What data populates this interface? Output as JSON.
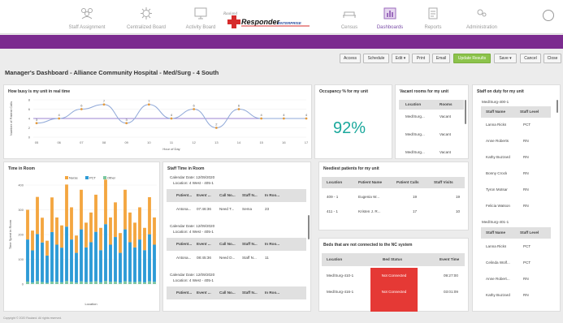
{
  "nav": {
    "items": [
      {
        "label": "Staff Assignment",
        "icon": "staff-icon"
      },
      {
        "label": "Centralized Board",
        "icon": "board-icon"
      },
      {
        "label": "Activity Board",
        "icon": "monitor-icon"
      },
      {
        "label": "Census",
        "icon": "bed-icon"
      },
      {
        "label": "Dashboards",
        "icon": "dashboard-icon"
      },
      {
        "label": "Reports",
        "icon": "report-icon"
      },
      {
        "label": "Administration",
        "icon": "admin-icon"
      }
    ],
    "logo_small": "Rauland",
    "logo_main": "Responder",
    "logo_edition": "ENTERPRISE",
    "active": "Dashboards"
  },
  "toolbar": {
    "buttons": [
      "Access",
      "Schedule",
      "Edit",
      "Print",
      "Email",
      "Update Results",
      "Save",
      "Cancel",
      "Close"
    ]
  },
  "page_title": "Manager's Dashboard - Alliance Community Hospital - Med/Surg - 4 South",
  "busy": {
    "title": "How busy is my unit in real time",
    "ylabel": "Number of Patient Calls",
    "xlabel": "Hour of Day",
    "chart_data": {
      "type": "line",
      "x": [
        "05",
        "06",
        "07",
        "08",
        "09",
        "10",
        "11",
        "12",
        "13",
        "14",
        "15",
        "16",
        "17"
      ],
      "values": [
        3,
        4,
        6,
        7,
        3,
        7,
        4,
        6,
        2,
        6,
        4,
        4,
        4
      ],
      "ylim": [
        0,
        8
      ],
      "series_color": "#8fa8d8"
    }
  },
  "occupancy": {
    "title": "Occupancy % for my unit",
    "value": "92%"
  },
  "vacant": {
    "title": "Vacant rooms for my unit",
    "headers": [
      "Location",
      "Rooms"
    ],
    "rows": [
      [
        "Med/Surg...",
        "Vacant"
      ],
      [
        "Med/Surg...",
        "Vacant"
      ],
      [
        "Med/Surg...",
        "Vacant"
      ]
    ]
  },
  "staff_on_duty": {
    "title": "Staff on duty for my unit",
    "group1": "Med/Surg-400-1",
    "group2": "Med/Surg-401-1",
    "headers": [
      "Staff Name",
      "Staff Level"
    ],
    "rows1": [
      [
        "Lanna Ricks",
        "PCT"
      ],
      [
        "Anne Roberts",
        "RN"
      ],
      [
        "Kathy Buzzard",
        "RN"
      ],
      [
        "Bonny Crock",
        "RN"
      ],
      [
        "Tyron Motsar",
        "RN"
      ],
      [
        "Felicia Watson",
        "RN"
      ]
    ],
    "rows2": [
      [
        "Lanna Ricks",
        "PCT"
      ],
      [
        "Celinda Wolf...",
        "PCT"
      ],
      [
        "Anne Robert...",
        "RN"
      ],
      [
        "Kathy Buzzard",
        "RN"
      ]
    ]
  },
  "time_in_room": {
    "title": "Time in Room",
    "ylabel": "Time Spent in Room",
    "xlabel": "Location",
    "legend": [
      "Nurse",
      "PCT",
      "Other"
    ],
    "chart_data": {
      "type": "bar",
      "stacked": true,
      "series": [
        {
          "name": "Nurse",
          "color": "#f4a640",
          "values": [
            120,
            80,
            150,
            100,
            60,
            140,
            110,
            90,
            170,
            130,
            70,
            160,
            100,
            120,
            150,
            90,
            180,
            110,
            140,
            80,
            160,
            120,
            100,
            130,
            90,
            150,
            110
          ]
        },
        {
          "name": "PCT",
          "color": "#2d9bd6",
          "values": [
            170,
            130,
            190,
            160,
            110,
            200,
            150,
            140,
            220,
            170,
            120,
            210,
            140,
            160,
            200,
            130,
            230,
            150,
            180,
            120,
            210,
            160,
            140,
            170,
            130,
            190,
            150
          ]
        },
        {
          "name": "Other",
          "color": "#7cc7a0",
          "values": [
            10,
            6,
            12,
            8,
            5,
            10,
            9,
            7,
            12,
            10,
            6,
            11,
            8,
            9,
            11,
            7,
            12,
            9,
            10,
            6,
            11,
            9,
            8,
            10,
            7,
            11,
            9
          ]
        }
      ],
      "ylim": [
        0,
        400
      ]
    }
  },
  "staff_time": {
    "title": "Staff Time in Room",
    "headers": [
      "Patient...",
      "Event ...",
      "Call No...",
      "Staff N...",
      "In Roo..."
    ],
    "blocks": [
      {
        "date": "Calendar Date: 12/09/2020",
        "loc": "Location: 4 West - 405-1",
        "row": [
          "Antona...",
          "07:46:36",
          "Need T...",
          "Sema",
          "23"
        ]
      },
      {
        "date": "Calendar Date: 12/09/2020",
        "loc": "Location: 4 West - 405-1",
        "row": [
          "Antona...",
          "08:45:36",
          "Need D...",
          "Staff N...",
          "11"
        ]
      },
      {
        "date": "Calendar Date: 12/09/2020",
        "loc": "Location: 4 West - 405-1",
        "row": [
          "",
          "",
          "",
          "",
          ""
        ]
      }
    ]
  },
  "neediest": {
    "title": "Neediest patients for my unit",
    "headers": [
      "Location",
      "Patient Name",
      "Patient Calls",
      "Staff Visits"
    ],
    "rows": [
      [
        "409 - 1",
        "Eugenia W...",
        "19",
        "19"
      ],
      [
        "411 - 1",
        "Kristen J. R...",
        "17",
        "10"
      ]
    ]
  },
  "beds": {
    "title": "Beds that are not connected to the NC system",
    "headers": [
      "Location",
      "Bed Status",
      "Event Time"
    ],
    "rows": [
      [
        "Med/Surg-410-1",
        "Not Connected",
        "09:27:00"
      ],
      [
        "Med/Surg-416-1",
        "Not Connected",
        "03:01:09"
      ]
    ]
  },
  "footer": "Copyright © 2020 Rauland. All rights reserved."
}
